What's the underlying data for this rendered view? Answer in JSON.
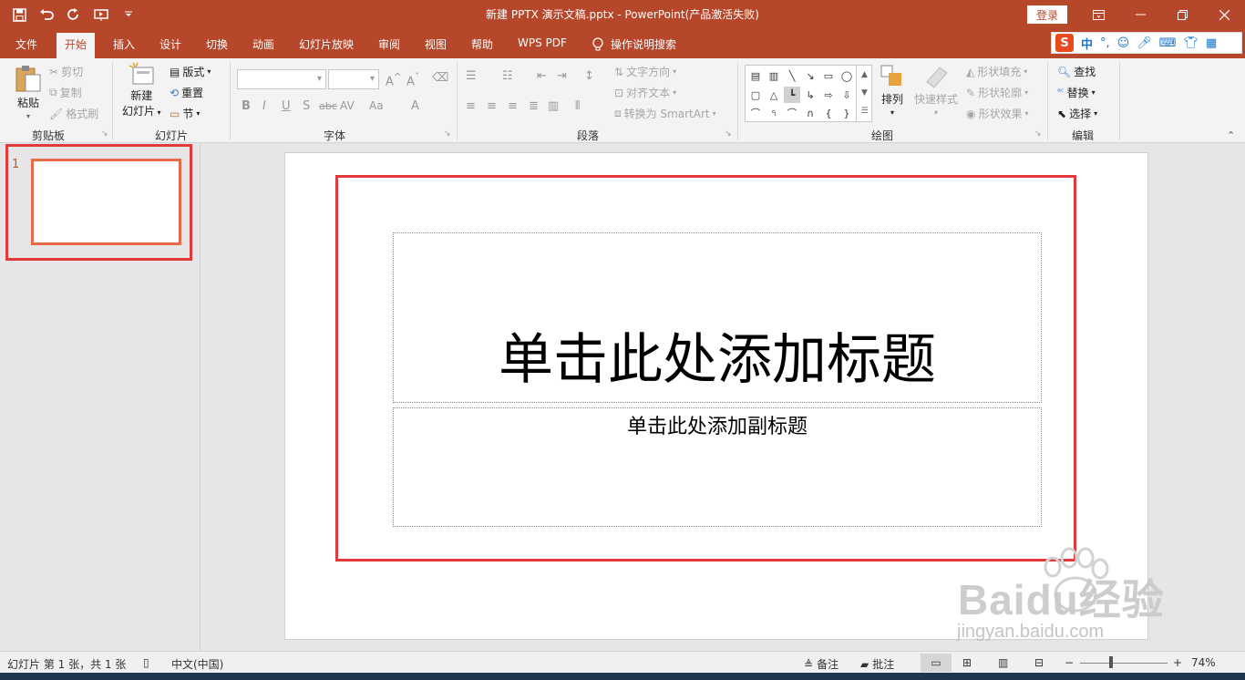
{
  "titlebar": {
    "document_title": "新建 PPTX 演示文稿.pptx  -  PowerPoint(产品激活失败)",
    "login_label": "登录",
    "qat_icons": [
      "save-icon",
      "undo-icon",
      "redo-icon",
      "present-from-start-icon",
      "customize-qat-icon"
    ]
  },
  "tabs": [
    "文件",
    "开始",
    "插入",
    "设计",
    "切换",
    "动画",
    "幻灯片放映",
    "审阅",
    "视图",
    "帮助",
    "WPS PDF"
  ],
  "active_tab": "开始",
  "tell_me": "操作说明搜索",
  "ime": {
    "label": "中"
  },
  "ribbon": {
    "clipboard": {
      "paste": "粘贴",
      "cut": "剪切",
      "copy": "复制",
      "format_painter": "格式刷",
      "group": "剪贴板"
    },
    "slides": {
      "new_slide_1": "新建",
      "new_slide_2": "幻灯片",
      "layout": "版式",
      "reset": "重置",
      "section": "节",
      "group": "幻灯片"
    },
    "font": {
      "group": "字体",
      "bold": "B",
      "italic": "I",
      "underline": "U",
      "shadow": "S",
      "strike": "abc",
      "spacing": "AV",
      "case": "Aa",
      "color": "A"
    },
    "paragraph": {
      "group": "段落",
      "text_direction": "文字方向",
      "align_text": "对齐文本",
      "smartart": "转换为 SmartArt"
    },
    "drawing": {
      "group": "绘图",
      "arrange": "排列",
      "quick_styles": "快速样式",
      "shape_fill": "形状填充",
      "shape_outline": "形状轮廓",
      "shape_effects": "形状效果"
    },
    "editing": {
      "group": "编辑",
      "find": "查找",
      "replace": "替换",
      "select": "选择"
    }
  },
  "thumbnails": [
    {
      "number": "1"
    }
  ],
  "slide": {
    "title_placeholder": "单击此处添加标题",
    "subtitle_placeholder": "单击此处添加副标题"
  },
  "status": {
    "slide_info": "幻灯片 第 1 张，共 1 张",
    "language": "中文(中国)",
    "notes": "备注",
    "comments": "批注",
    "zoom_minus": "−",
    "zoom_plus": "+",
    "zoom": "74%"
  },
  "watermark": {
    "logo": "Baidu经验",
    "url": "jingyan.baidu.com"
  },
  "colors": {
    "accent": "#b7472a",
    "highlight_box": "#e2393a"
  }
}
